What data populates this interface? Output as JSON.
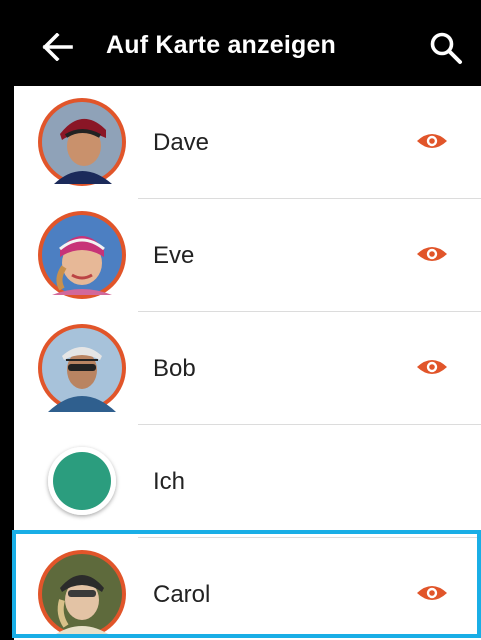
{
  "appbar": {
    "title": "Auf Karte anzeigen",
    "back_icon": "arrow-left-icon",
    "search_icon": "search-icon"
  },
  "colors": {
    "accent": "#e1552a",
    "selection": "#19aee6",
    "self_dot": "#2b9d7e",
    "appbar_bg": "#000000"
  },
  "contacts": [
    {
      "name": "Dave",
      "visible": true,
      "icon": "eye-icon"
    },
    {
      "name": "Eve",
      "visible": true,
      "icon": "eye-icon"
    },
    {
      "name": "Bob",
      "visible": true,
      "icon": "eye-icon"
    },
    {
      "name": "Ich",
      "visible": false
    },
    {
      "name": "Carol",
      "visible": true,
      "icon": "eye-icon",
      "selected": true
    }
  ]
}
